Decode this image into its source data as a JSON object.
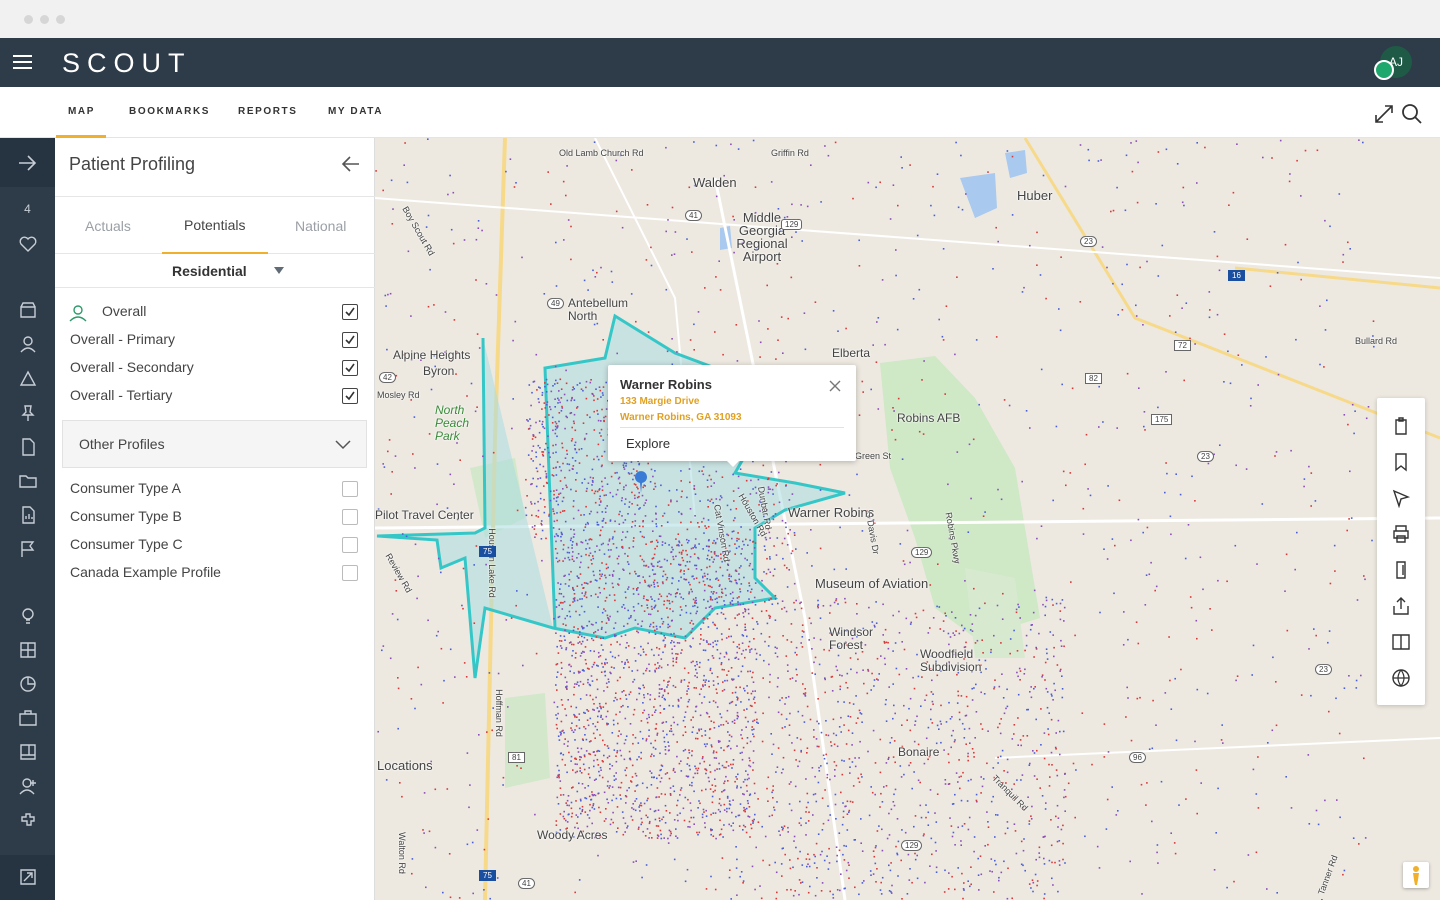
{
  "app": {
    "logo_text": "SCOUT",
    "user_initials": "AJ"
  },
  "nav": {
    "tabs": [
      "MAP",
      "BOOKMARKS",
      "REPORTS",
      "MY DATA"
    ],
    "active_tab": "MAP"
  },
  "rail": {
    "bookmark_count": "4",
    "icons": [
      "arrow-right-icon",
      "heart-icon",
      "store-icon",
      "person-icon",
      "cone-icon",
      "pin-icon",
      "document-icon",
      "folder-icon",
      "report-icon",
      "flag-icon",
      "lightbulb-icon",
      "grid-icon",
      "pie-chart-icon",
      "briefcase-icon",
      "layout-icon",
      "user-add-icon",
      "puzzle-icon",
      "exit-icon"
    ]
  },
  "panel": {
    "title": "Patient Profiling",
    "tabs": [
      {
        "label": "Actuals",
        "active": false
      },
      {
        "label": "Potentials",
        "active": true
      },
      {
        "label": "National",
        "active": false
      }
    ],
    "selected_type": "Residential",
    "profiles": [
      {
        "label": "Overall",
        "checked": true
      },
      {
        "label": "Overall - Primary",
        "checked": true
      },
      {
        "label": "Overall - Secondary",
        "checked": true
      },
      {
        "label": "Overall - Tertiary",
        "checked": true
      }
    ],
    "other_profiles_label": "Other Profiles",
    "other_profiles": [
      {
        "label": "Consumer Type A",
        "checked": false
      },
      {
        "label": "Consumer Type B",
        "checked": false
      },
      {
        "label": "Consumer Type C",
        "checked": false
      },
      {
        "label": "Canada Example Profile",
        "checked": false
      }
    ]
  },
  "map": {
    "places": [
      "Walden",
      "Middle Georgia Regional Airport",
      "Huber",
      "Antebellum North",
      "Alpine Heights",
      "Byron",
      "North Peach Park",
      "Elberta",
      "Robins AFB",
      "Warner Robins",
      "Museum of Aviation",
      "Windsor Forest",
      "Woodfield Subdivision",
      "Bonaire",
      "Woody Acres",
      "Locations",
      "Pilot Travel Center"
    ],
    "roads": [
      "Griffin Rd",
      "Bullard Rd",
      "Boy Scout Rd",
      "Mosley Rd",
      "Green St",
      "Dunbar Rd",
      "S Davis Dr",
      "Robins Pkwy",
      "Review Rd",
      "Houston Lake Rd",
      "Hoffman Rd",
      "Walton Rd",
      "Old Lamb Church Rd",
      "Cat Vinson Rd",
      "Houston Rd",
      "Tanner Rd",
      "Tranquil Rd"
    ],
    "route_shields": [
      "41",
      "129",
      "23",
      "49",
      "16",
      "72",
      "82",
      "175",
      "23",
      "75",
      "129",
      "81",
      "96",
      "23",
      "129",
      "75",
      "41",
      "42"
    ],
    "popup": {
      "name": "Warner Robins",
      "address_line1": "133 Margie Drive",
      "address_line2": "Warner Robins, GA 31093",
      "action": "Explore"
    },
    "dot_colors": [
      "#d63a3a",
      "#4a5fd6",
      "#8a4fb8"
    ],
    "trade_area_color": "#35c7c7"
  },
  "toolbox": {
    "tools": [
      "clipboard-icon",
      "bookmark-icon",
      "cursor-icon",
      "print-icon",
      "mobile-icon",
      "share-icon",
      "split-view-icon",
      "globe-icon"
    ]
  }
}
